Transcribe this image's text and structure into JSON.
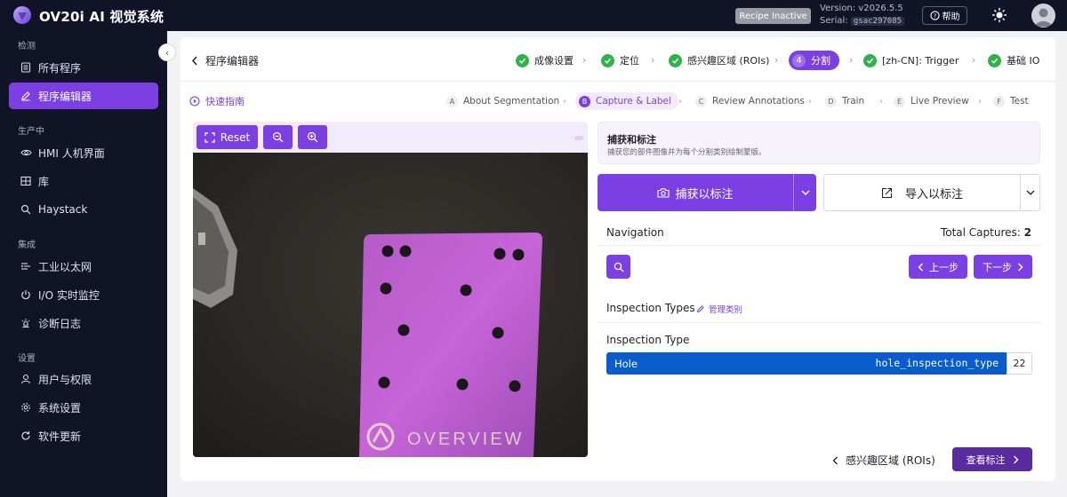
{
  "app": {
    "title": "OV20i AI 视觉系统",
    "recipe_status": "Recipe Inactive",
    "version": "Version: v2026.5.5",
    "serial_label": "Serial:",
    "serial_value": "gsac297085",
    "help_label": "帮助"
  },
  "sidebar": {
    "sections": [
      {
        "label": "检测"
      },
      {
        "label": "生产中"
      },
      {
        "label": "集成"
      },
      {
        "label": "设置"
      }
    ],
    "items": [
      {
        "label": "所有程序",
        "icon": "list-icon"
      },
      {
        "label": "程序编辑器",
        "icon": "pencil-icon",
        "active": true
      },
      {
        "label": "HMI 人机界面",
        "icon": "eye-icon"
      },
      {
        "label": "库",
        "icon": "grid-icon"
      },
      {
        "label": "Haystack",
        "icon": "search-icon"
      },
      {
        "label": "工业以太网",
        "icon": "network-icon"
      },
      {
        "label": "I/O 实时监控",
        "icon": "power-icon"
      },
      {
        "label": "诊断日志",
        "icon": "lamp-icon"
      },
      {
        "label": "用户与权限",
        "icon": "user-icon"
      },
      {
        "label": "系统设置",
        "icon": "gear-icon"
      },
      {
        "label": "软件更新",
        "icon": "refresh-icon"
      }
    ]
  },
  "editor": {
    "title": "程序编辑器",
    "steps": [
      {
        "label": "成像设置",
        "done": true
      },
      {
        "label": "定位",
        "done": true
      },
      {
        "label": "感兴趣区域 (ROIs)",
        "done": true
      },
      {
        "label": "分割",
        "number": "4",
        "active": true
      },
      {
        "label": "[zh-CN]: Trigger",
        "done": true
      },
      {
        "label": "基础 IO",
        "done": true
      }
    ],
    "quick_guide": "快速指南",
    "substeps": [
      {
        "letter": "A",
        "label": "About Segmentation"
      },
      {
        "letter": "B",
        "label": "Capture & Label",
        "active": true
      },
      {
        "letter": "C",
        "label": "Review Annotations"
      },
      {
        "letter": "D",
        "label": "Train"
      },
      {
        "letter": "E",
        "label": "Live Preview"
      },
      {
        "letter": "F",
        "label": "Test"
      }
    ]
  },
  "image_pane": {
    "reset_label": "Reset",
    "watermark": "OVERVIEW"
  },
  "capture": {
    "title": "捕获和标注",
    "description": "捕获您的部件图像并为每个分割类别绘制蒙版。",
    "capture_button": "捕获以标注",
    "import_button": "导入以标注"
  },
  "navigation": {
    "title": "Navigation",
    "captures_label": "Total Captures:",
    "captures_value": "2",
    "prev_label": "上一步",
    "next_label": "下一步"
  },
  "inspection": {
    "title": "Inspection Types",
    "manage_label": "管理类别",
    "type_label": "Inspection Type",
    "type_name": "Hole",
    "type_code": "hole_inspection_type",
    "type_count": "22"
  },
  "footer": {
    "back_label": "感兴趣区域 (ROIs)",
    "next_label": "查看标注"
  },
  "colors": {
    "accent": "#7b3fe4",
    "sidebar_bg": "#111427",
    "success": "#2fb24a",
    "selected_type": "#0a5bcc"
  }
}
